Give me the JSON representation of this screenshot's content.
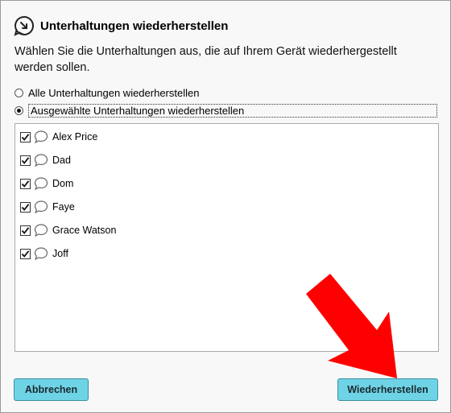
{
  "dialog": {
    "title": "Unterhaltungen wiederherstellen",
    "description": "Wählen Sie die Unterhaltungen aus, die auf Ihrem Gerät wiederhergestellt werden sollen.",
    "options": [
      {
        "label": "Alle Unterhaltungen wiederherstellen",
        "selected": false
      },
      {
        "label": "Ausgewählte Unterhaltungen wiederherstellen",
        "selected": true
      }
    ],
    "conversations": [
      {
        "name": "Alex Price",
        "checked": true
      },
      {
        "name": "Dad",
        "checked": true
      },
      {
        "name": "Dom",
        "checked": true
      },
      {
        "name": "Faye",
        "checked": true
      },
      {
        "name": "Grace Watson",
        "checked": true
      },
      {
        "name": "Joff",
        "checked": true
      }
    ],
    "cancel_label": "Abbrechen",
    "restore_label": "Wiederherstellen"
  },
  "colors": {
    "button_bg": "#6fd3e6",
    "arrow": "#ff0000"
  },
  "icons": [
    "restore-icon",
    "chat-bubble-icon",
    "checkmark-icon"
  ]
}
